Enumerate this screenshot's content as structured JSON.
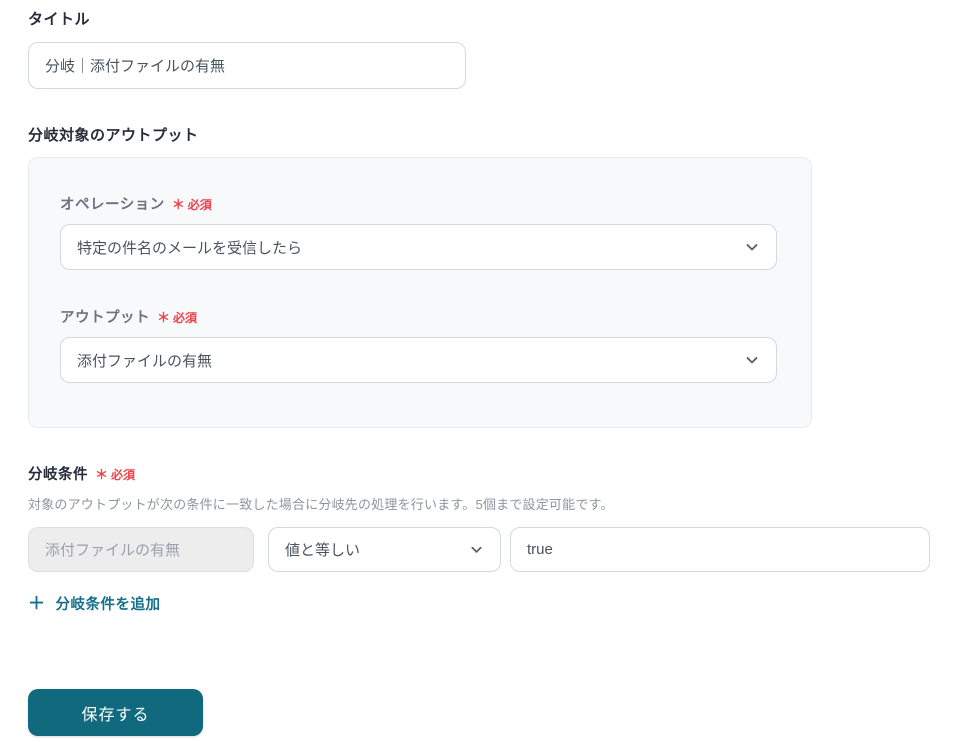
{
  "form": {
    "title_field": {
      "label": "タイトル",
      "value": "分岐｜添付ファイルの有無"
    },
    "required_marker": "＊",
    "output_section": {
      "label": "分岐対象のアウトプット",
      "operation": {
        "label": "オペレーション",
        "required_label": "必須",
        "value": "特定の件名のメールを受信したら"
      },
      "output": {
        "label": "アウトプット",
        "required_label": "必須",
        "value": "添付ファイルの有無"
      }
    },
    "condition_section": {
      "label": "分岐条件",
      "required_label": "必須",
      "description": "対象のアウトプットが次の条件に一致した場合に分岐先の処理を行います。5個まで設定可能です。",
      "conditions": [
        {
          "target": "添付ファイルの有無",
          "operator": "値と等しい",
          "value": "true"
        }
      ],
      "add_icon": "＋",
      "add_label": "分岐条件を追加"
    },
    "save_button_label": "保存する"
  },
  "colors": {
    "accent_teal": "#11697e",
    "link_teal": "#16708a",
    "required_red": "#f0424d",
    "panel_bg": "#f8f9fa",
    "disabled_bg": "#ededee"
  }
}
